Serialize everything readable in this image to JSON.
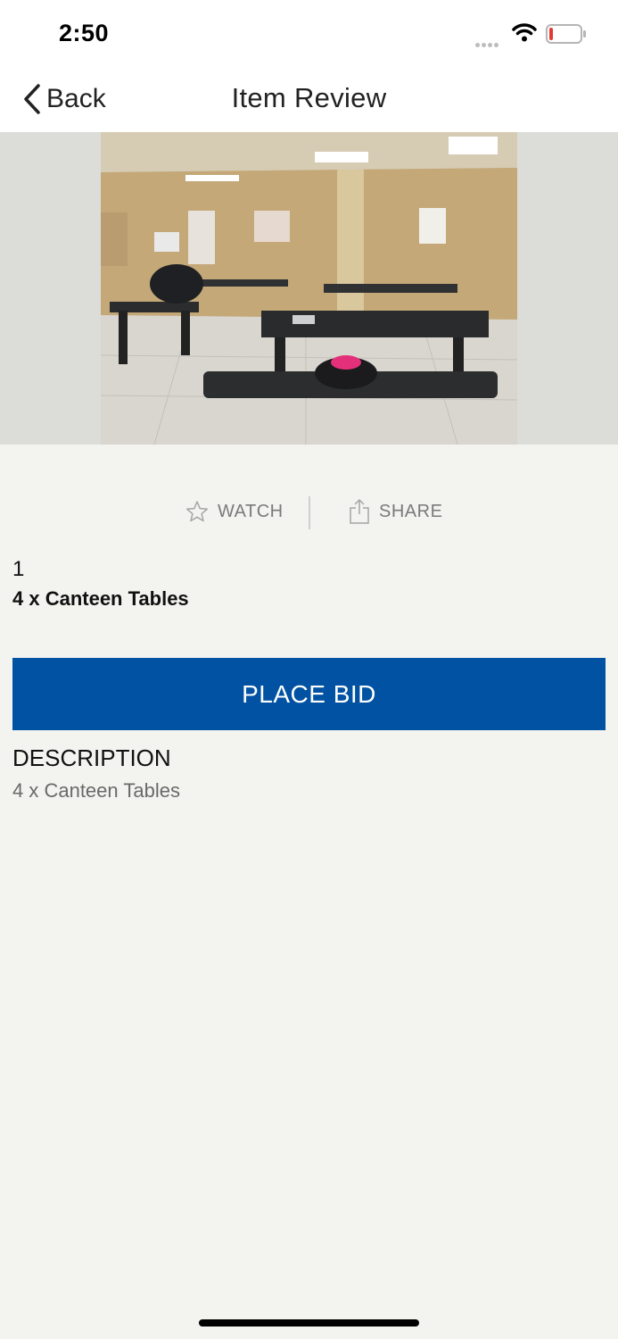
{
  "status_bar": {
    "time": "2:50"
  },
  "nav": {
    "back_label": "Back",
    "title": "Item Review"
  },
  "actions": {
    "watch_label": "WATCH",
    "share_label": "SHARE"
  },
  "item": {
    "lot_number": "1",
    "title": "4 x Canteen Tables",
    "place_bid_label": "PLACE BID",
    "description_heading": "DESCRIPTION",
    "description_text": "4 x Canteen Tables"
  },
  "colors": {
    "accent": "#0152a2",
    "background": "#f3f3f0",
    "battery_low": "#e53935"
  }
}
